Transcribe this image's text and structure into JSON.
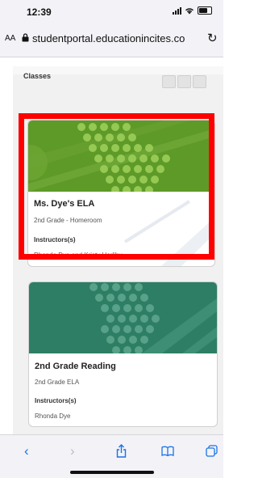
{
  "status_bar": {
    "time": "12:39"
  },
  "browser": {
    "aa_label": "AA",
    "url": "studentportal.educationincites.co",
    "reload_icon": "reload-icon",
    "toolbar": {
      "back": "back-icon",
      "forward": "forward-icon",
      "share": "share-icon",
      "bookmarks": "bookmarks-icon",
      "tabs": "tabs-icon"
    }
  },
  "page": {
    "section_label": "Classes",
    "classes": [
      {
        "title": "Ms. Dye's ELA",
        "subtitle": "2nd Grade - Homeroom",
        "instructors_label": "Instructors(s)",
        "instructors": "Rhonda Dye and Kristy Herlihy",
        "banner_color": "#5e9a27"
      },
      {
        "title": "2nd Grade Reading",
        "subtitle": "2nd Grade ELA",
        "instructors_label": "Instructors(s)",
        "instructors": "Rhonda Dye",
        "banner_color": "#2e7e65"
      }
    ]
  },
  "colors": {
    "highlight": "#ff0000",
    "ios_blue": "#1a73e8"
  }
}
